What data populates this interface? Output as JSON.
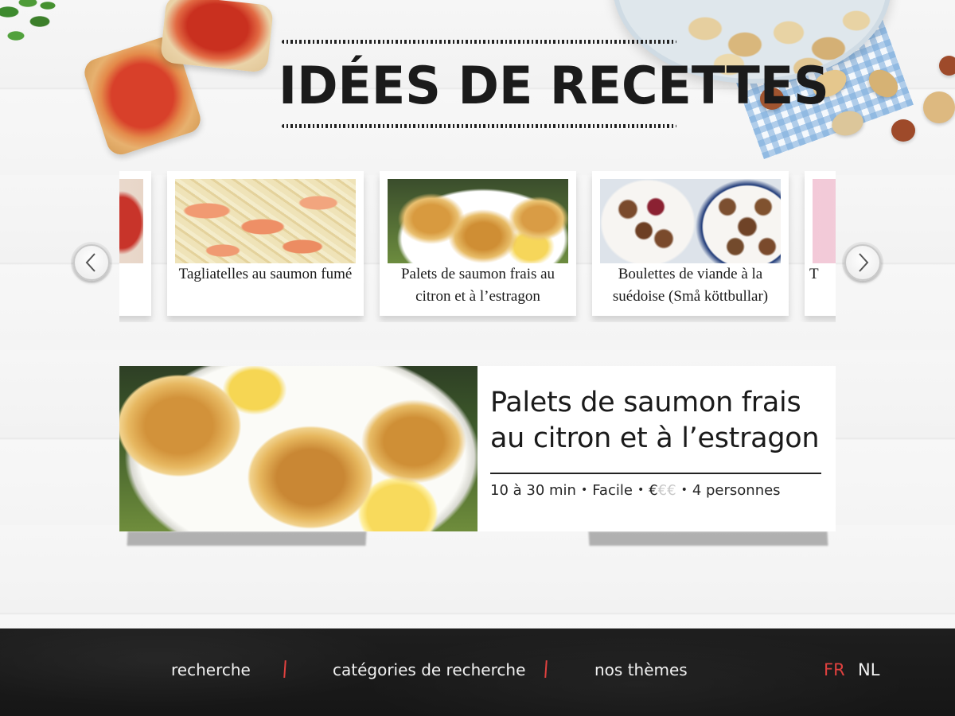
{
  "page": {
    "title": "IDÉES DE RECETTES"
  },
  "carousel": {
    "prev_icon": "chevron-left-icon",
    "next_icon": "chevron-right-icon",
    "cards": [
      {
        "title": "",
        "photo": "partial-left"
      },
      {
        "title": "Tagliatelles au saumon fumé",
        "photo": "pasta"
      },
      {
        "title": "Palets de saumon frais au citron et à l’estragon",
        "photo": "fishcakes"
      },
      {
        "title": "Boulettes de viande à la suédoise (Små köttbullar)",
        "photo": "meatballs"
      },
      {
        "title": "T",
        "photo": "partial-right"
      }
    ]
  },
  "featured": {
    "title": "Palets de saumon frais au citron et à l’estragon",
    "time": "10 à 30 min",
    "difficulty": "Facile",
    "price_active": "€",
    "price_inactive": "€€",
    "servings": "4 personnes",
    "separator": "•"
  },
  "footer": {
    "links": [
      "recherche",
      "catégories de recherche",
      "nos thèmes"
    ],
    "separator": "|",
    "languages": {
      "active": "FR",
      "other": "NL"
    },
    "colors": {
      "accent": "#e0413f",
      "text": "#f2f2f2",
      "background": "#1b1b1b"
    }
  }
}
